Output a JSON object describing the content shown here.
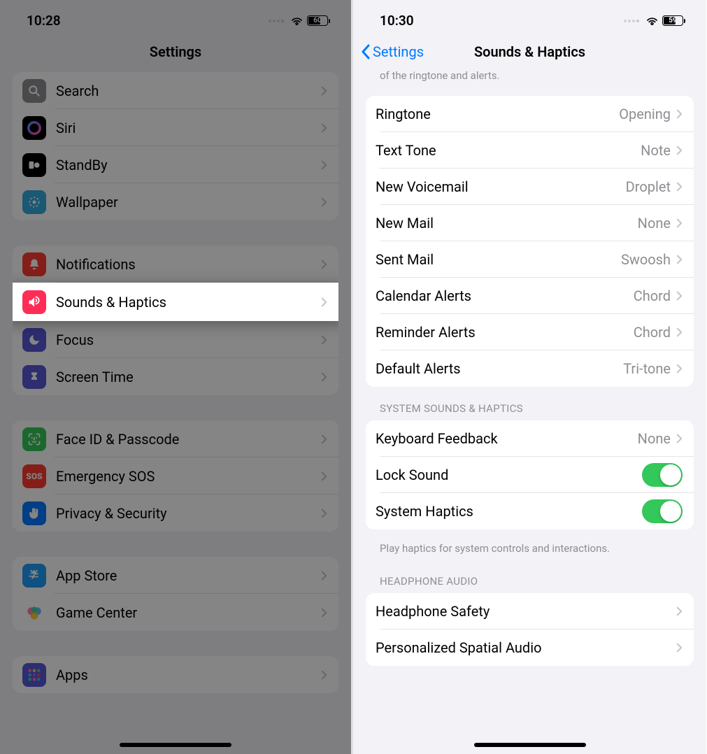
{
  "left": {
    "status": {
      "time": "10:28",
      "battery": "60"
    },
    "title": "Settings",
    "g1": [
      {
        "name": "search",
        "label": "Search",
        "icon": "search-icon",
        "bg": "#8e8e93"
      },
      {
        "name": "siri",
        "label": "Siri",
        "icon": "siri-icon",
        "bg": "grad-siri"
      },
      {
        "name": "standby",
        "label": "StandBy",
        "icon": "standby-icon",
        "bg": "#000"
      },
      {
        "name": "wallpaper",
        "label": "Wallpaper",
        "icon": "wallpaper-icon",
        "bg": "#34aadc"
      }
    ],
    "g2": [
      {
        "name": "notifications",
        "label": "Notifications",
        "icon": "bell-icon",
        "bg": "#ff3b30"
      },
      {
        "name": "sounds-haptics",
        "label": "Sounds & Haptics",
        "icon": "speaker-icon",
        "bg": "#ff2d55",
        "hl": true
      },
      {
        "name": "focus",
        "label": "Focus",
        "icon": "moon-icon",
        "bg": "#5856d6"
      },
      {
        "name": "screen-time",
        "label": "Screen Time",
        "icon": "hourglass-icon",
        "bg": "#5856d6"
      }
    ],
    "g3": [
      {
        "name": "face-id",
        "label": "Face ID & Passcode",
        "icon": "faceid-icon",
        "bg": "#34c759"
      },
      {
        "name": "emergency-sos",
        "label": "Emergency SOS",
        "icon": "sos-icon",
        "bg": "#ff3b30"
      },
      {
        "name": "privacy",
        "label": "Privacy & Security",
        "icon": "hand-icon",
        "bg": "#007aff"
      }
    ],
    "g4": [
      {
        "name": "app-store",
        "label": "App Store",
        "icon": "appstore-icon",
        "bg": "#1d9bf6"
      },
      {
        "name": "game-center",
        "label": "Game Center",
        "icon": "gamecenter-icon",
        "bg": "#fff"
      }
    ],
    "g5": [
      {
        "name": "apps",
        "label": "Apps",
        "icon": "apps-icon",
        "bg": "#5856d6"
      }
    ]
  },
  "right": {
    "status": {
      "time": "10:30",
      "battery": "59"
    },
    "back": "Settings",
    "title": "Sounds & Haptics",
    "clip_top": "of the ringtone and alerts.",
    "g1": [
      {
        "name": "ringtone",
        "label": "Ringtone",
        "value": "Opening"
      },
      {
        "name": "text-tone",
        "label": "Text Tone",
        "value": "Note"
      },
      {
        "name": "new-voicemail",
        "label": "New Voicemail",
        "value": "Droplet"
      },
      {
        "name": "new-mail",
        "label": "New Mail",
        "value": "None"
      },
      {
        "name": "sent-mail",
        "label": "Sent Mail",
        "value": "Swoosh"
      },
      {
        "name": "calendar-alerts",
        "label": "Calendar Alerts",
        "value": "Chord"
      },
      {
        "name": "reminder-alerts",
        "label": "Reminder Alerts",
        "value": "Chord"
      },
      {
        "name": "default-alerts",
        "label": "Default Alerts",
        "value": "Tri-tone"
      }
    ],
    "sec2_hdr": "SYSTEM SOUNDS & HAPTICS",
    "g2": [
      {
        "name": "keyboard-feedback",
        "label": "Keyboard Feedback",
        "type": "link",
        "value": "None"
      },
      {
        "name": "lock-sound",
        "label": "Lock Sound",
        "type": "toggle",
        "on": true
      },
      {
        "name": "system-haptics",
        "label": "System Haptics",
        "type": "toggle",
        "on": true
      }
    ],
    "sec2_ftr": "Play haptics for system controls and interactions.",
    "sec3_hdr": "HEADPHONE AUDIO",
    "g3": [
      {
        "name": "headphone-safety",
        "label": "Headphone Safety"
      },
      {
        "name": "spatial-audio",
        "label": "Personalized Spatial Audio"
      }
    ]
  }
}
